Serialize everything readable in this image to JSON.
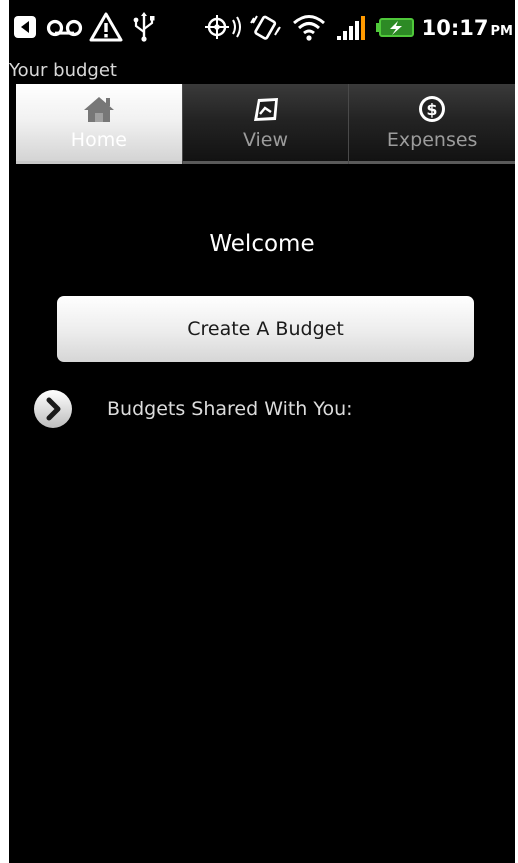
{
  "status_bar": {
    "icons": [
      "back-arrow-icon",
      "voicemail-icon",
      "warning-icon",
      "usb-icon",
      "gps-icon",
      "vibrate-icon",
      "wifi-icon",
      "signal-icon",
      "battery-charging-icon"
    ],
    "time": "10:17",
    "ampm": "PM"
  },
  "app": {
    "title": "Your budget"
  },
  "tabs": [
    {
      "label": "Home",
      "icon": "home-icon",
      "selected": true
    },
    {
      "label": "View",
      "icon": "view-icon",
      "selected": false
    },
    {
      "label": "Expenses",
      "icon": "dollar-coin-icon",
      "selected": false
    }
  ],
  "main": {
    "welcome": "Welcome",
    "create_button": "Create A Budget",
    "shared_label": "Budgets Shared With You:"
  },
  "colors": {
    "background": "#000000",
    "battery_green": "#4fc83a",
    "signal_orange": "#ff9a00"
  }
}
